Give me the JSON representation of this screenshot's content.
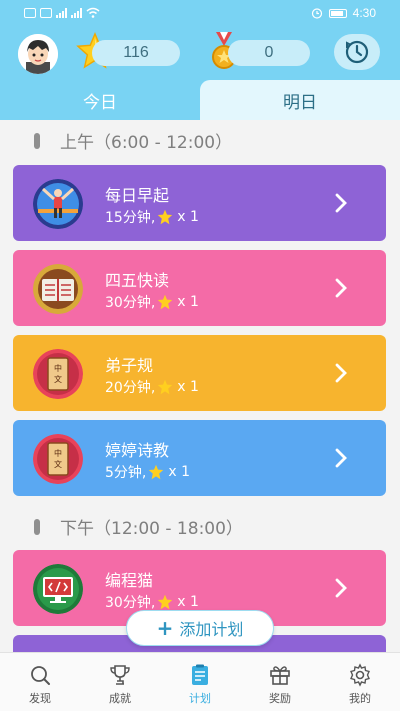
{
  "status_bar": {
    "time": "4:30"
  },
  "header": {
    "stars": "116",
    "medals": "0"
  },
  "tabs": [
    {
      "label": "今日",
      "active": false
    },
    {
      "label": "明日",
      "active": true
    }
  ],
  "sections": [
    {
      "title": "上午（6:00 - 12:00）"
    },
    {
      "title": "下午（12:00 - 18:00）"
    }
  ],
  "tasks": [
    {
      "title": "每日早起",
      "duration": "15分钟,",
      "reward": "x 1",
      "color": "#8e63d6",
      "icon": "exercise-icon"
    },
    {
      "title": "四五快读",
      "duration": "30分钟,",
      "reward": "x 1",
      "color": "#f46ba7",
      "icon": "book-icon"
    },
    {
      "title": "弟子规",
      "duration": "20分钟,",
      "reward": "x 1",
      "color": "#f7b42e",
      "icon": "chinese-book-icon"
    },
    {
      "title": "婷婷诗教",
      "duration": "5分钟,",
      "reward": "x 1",
      "color": "#5aa8f2",
      "icon": "chinese-book-icon"
    },
    {
      "title": "编程猫",
      "duration": "30分钟,",
      "reward": "x 1",
      "color": "#f46ba7",
      "icon": "code-screen-icon"
    }
  ],
  "book_icon_text": [
    "中",
    "文"
  ],
  "add_button": {
    "label": "添加计划"
  },
  "bottom_nav": [
    {
      "label": "发现",
      "icon": "search-icon",
      "active": false
    },
    {
      "label": "成就",
      "icon": "trophy-icon",
      "active": false
    },
    {
      "label": "计划",
      "icon": "plan-icon",
      "active": true
    },
    {
      "label": "奖励",
      "icon": "gift-icon",
      "active": false
    },
    {
      "label": "我的",
      "icon": "gear-icon",
      "active": false
    }
  ]
}
